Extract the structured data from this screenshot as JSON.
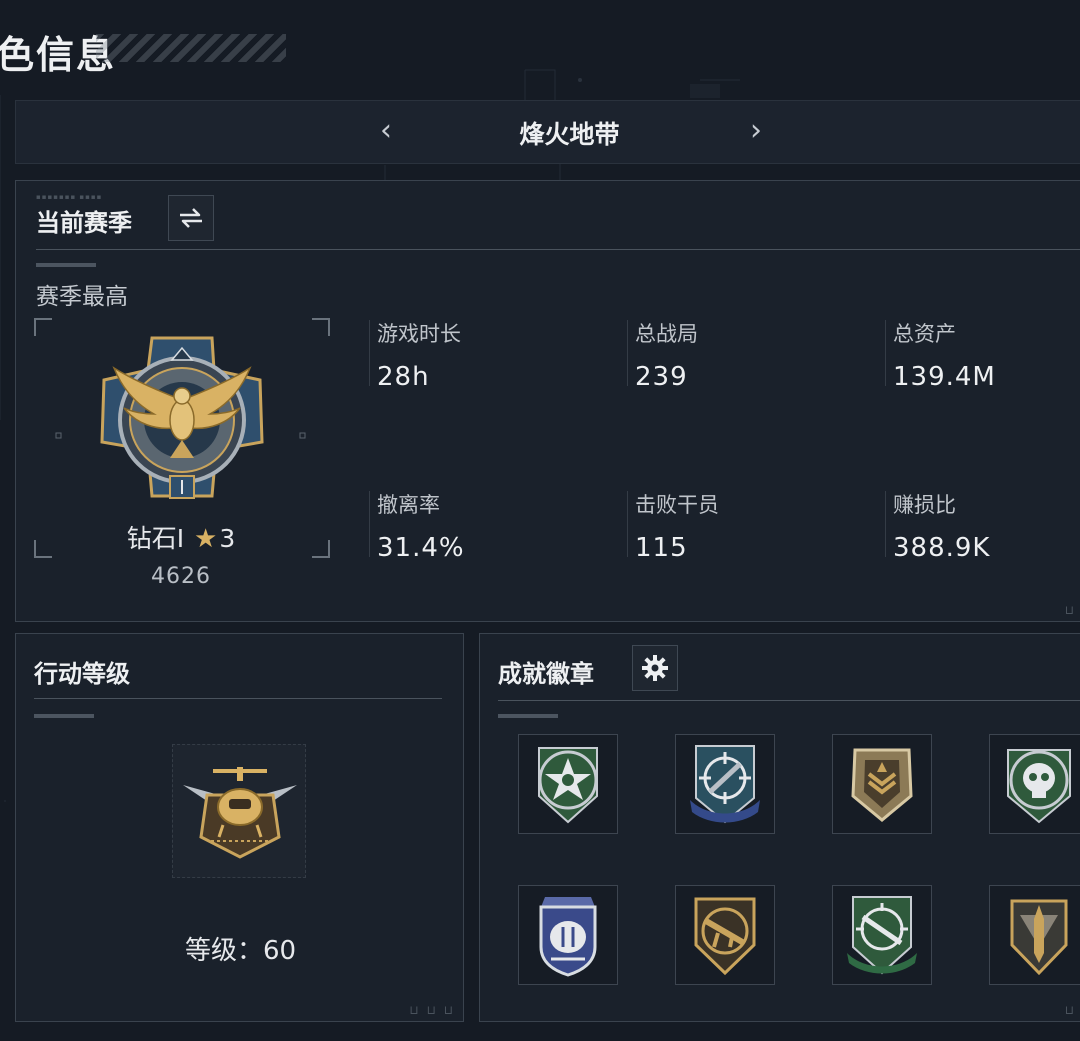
{
  "page": {
    "title": "色信息"
  },
  "mode_bar": {
    "prev_label": "‹",
    "mode_name": "烽火地带",
    "next_label": "›"
  },
  "season": {
    "header": "当前赛季",
    "switch_icon": "swap-icon",
    "subheader": "赛季最高",
    "rank": {
      "name": "钻石Ⅰ",
      "star_icon": "star-icon",
      "stars": "3",
      "score": "4626",
      "emblem_icon": "eagle-rank-emblem-icon"
    },
    "stats": [
      {
        "label": "游戏时长",
        "value": "28h"
      },
      {
        "label": "总战局",
        "value": "239"
      },
      {
        "label": "总资产",
        "value": "139.4M"
      },
      {
        "label": "撤离率",
        "value": "31.4%"
      },
      {
        "label": "击败干员",
        "value": "115"
      },
      {
        "label": "赚损比",
        "value": "388.9K"
      }
    ]
  },
  "level": {
    "header": "行动等级",
    "emblem_icon": "helicopter-level-emblem-icon",
    "level_text": "等级：60"
  },
  "badges": {
    "header": "成就徽章",
    "settings_icon": "gear-icon",
    "items": [
      {
        "icon": "green-star-badge-icon"
      },
      {
        "icon": "blue-crosshair-badge-icon"
      },
      {
        "icon": "tan-shield-badge-icon"
      },
      {
        "icon": "green-skull-badge-icon"
      },
      {
        "icon": "blue-police-badge-icon"
      },
      {
        "icon": "gold-rifle-badge-icon"
      },
      {
        "icon": "green-rifle-badge-icon"
      },
      {
        "icon": "gold-dagger-badge-icon"
      }
    ]
  },
  "colors": {
    "background": "#151b24",
    "panel": "#1a212b",
    "gold": "#d9b264",
    "text": "#eef0f2"
  }
}
